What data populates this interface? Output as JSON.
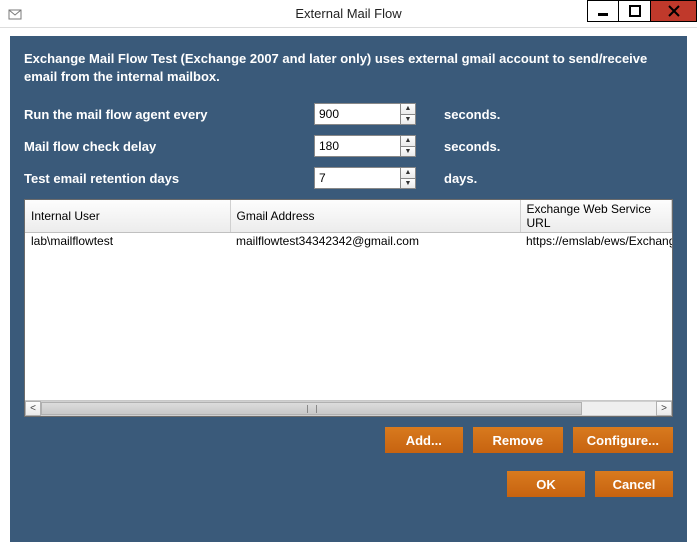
{
  "window": {
    "title": "External Mail Flow"
  },
  "intro": "Exchange Mail Flow Test (Exchange 2007 and later only) uses external gmail account to send/receive email from the internal mailbox.",
  "fields": {
    "runEvery": {
      "label": "Run the mail flow agent every",
      "value": "900",
      "unit": "seconds."
    },
    "checkDelay": {
      "label": "Mail flow check delay",
      "value": "180",
      "unit": "seconds."
    },
    "retention": {
      "label": "Test email retention days",
      "value": "7",
      "unit": "days."
    }
  },
  "table": {
    "columns": [
      "Internal User",
      "Gmail Address",
      "Exchange Web Service URL"
    ],
    "rows": [
      {
        "user": "lab\\mailflowtest",
        "gmail": "mailflowtest34342342@gmail.com",
        "ews": "https://emslab/ews/Exchange."
      }
    ]
  },
  "buttons": {
    "add": "Add...",
    "remove": "Remove",
    "configure": "Configure...",
    "ok": "OK",
    "cancel": "Cancel"
  }
}
